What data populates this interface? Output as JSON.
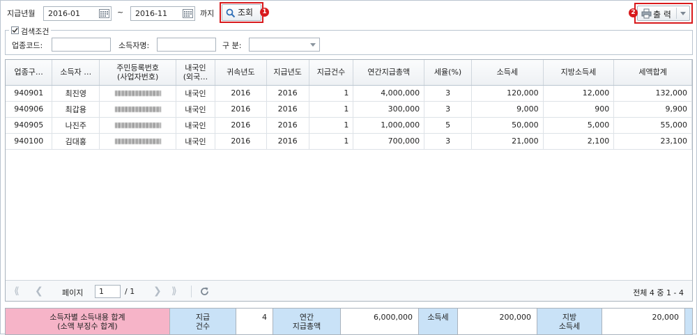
{
  "filters": {
    "date_label": "지급년월",
    "date_from": "2016-01",
    "tilde": "~",
    "date_to": "2016-11",
    "until": "까지",
    "search_label": "조회",
    "print_label": "출 력",
    "badge1": "1",
    "badge2": "2"
  },
  "conditions": {
    "legend": "검색조건",
    "biz_code_label": "업종코드:",
    "biz_code_value": "",
    "name_label": "소득자명:",
    "name_value": "",
    "type_label": "구 분:",
    "type_value": ""
  },
  "grid": {
    "headers": [
      [
        "업종구…",
        ""
      ],
      [
        "소득자 …",
        ""
      ],
      [
        "주민등록번호",
        "(사업자번호)"
      ],
      [
        "내국인",
        "(외국…"
      ],
      [
        "귀속년도",
        ""
      ],
      [
        "지급년도",
        ""
      ],
      [
        "지급건수",
        ""
      ],
      [
        "연간지급총액",
        ""
      ],
      [
        "세율(%)",
        ""
      ],
      [
        "소득세",
        ""
      ],
      [
        "지방소득세",
        ""
      ],
      [
        "세액합계",
        ""
      ]
    ],
    "rows": [
      [
        "940901",
        "최진영",
        "",
        "내국인",
        "2016",
        "2016",
        "1",
        "4,000,000",
        "3",
        "120,000",
        "12,000",
        "132,000"
      ],
      [
        "940906",
        "최갑용",
        "",
        "내국인",
        "2016",
        "2016",
        "1",
        "300,000",
        "3",
        "9,000",
        "900",
        "9,900"
      ],
      [
        "940905",
        "나진주",
        "",
        "내국인",
        "2016",
        "2016",
        "1",
        "1,000,000",
        "5",
        "50,000",
        "5,000",
        "55,000"
      ],
      [
        "940100",
        "김대홍",
        "",
        "내국인",
        "2016",
        "2016",
        "1",
        "700,000",
        "3",
        "21,000",
        "2,100",
        "23,100"
      ]
    ]
  },
  "pager": {
    "page_label": "페이지",
    "page_value": "1",
    "total_pages": "/ 1",
    "total_text": "전체 4 중 1 - 4"
  },
  "summary": {
    "title_line1": "소득자별 소득내용 합계",
    "title_line2": "(소액 부징수 합계)",
    "count_label_1": "지급",
    "count_label_2": "건수",
    "count_value": "4",
    "amount_label_1": "연간",
    "amount_label_2": "지급총액",
    "amount_value": "6,000,000",
    "tax_label": "소득세",
    "tax_value": "200,000",
    "local_label_1": "지방",
    "local_label_2": "소득세",
    "local_value": "20,000"
  },
  "colors": {
    "highlight": "#d8191c",
    "summary_pink": "#f6b4c8",
    "summary_blue": "#c9e2f7"
  }
}
